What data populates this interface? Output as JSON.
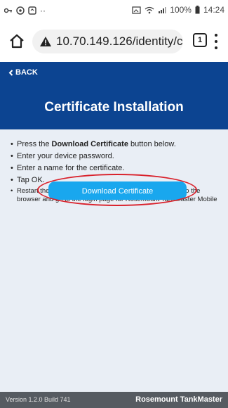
{
  "status_bar": {
    "dots": "··",
    "battery": "100%",
    "time": "14:24",
    "icons_left": [
      "key-icon",
      "eye-icon",
      "screen-icon"
    ],
    "icons_right": [
      "cast-icon",
      "wifi-icon",
      "signal-icon",
      "battery-icon"
    ]
  },
  "browser": {
    "url": "10.70.149.126/identity/c",
    "tab_count": "1"
  },
  "page": {
    "back_label": "BACK",
    "title": "Certificate Installation",
    "instructions": [
      {
        "prefix": "Press the ",
        "bold": "Download Certificate",
        "suffix": " button below."
      },
      {
        "text": "Enter your device password."
      },
      {
        "text": "Enter a name for the certificate."
      },
      {
        "text": "Tap OK."
      },
      {
        "text": "Restart the browser to enable loading of the certificate into the browser and go to the login page for Rosemount TankMaster Mobile"
      }
    ],
    "download_button_label": "Download Certificate"
  },
  "footer": {
    "version": "Version 1.2.0 Build 741",
    "brand": "Rosemount TankMaster"
  },
  "colors": {
    "header_bg": "#0c4491",
    "content_bg": "#e9eef5",
    "button_bg": "#19a7ee",
    "annotation_ring": "#d9212b",
    "footer_bg": "#565b61"
  }
}
